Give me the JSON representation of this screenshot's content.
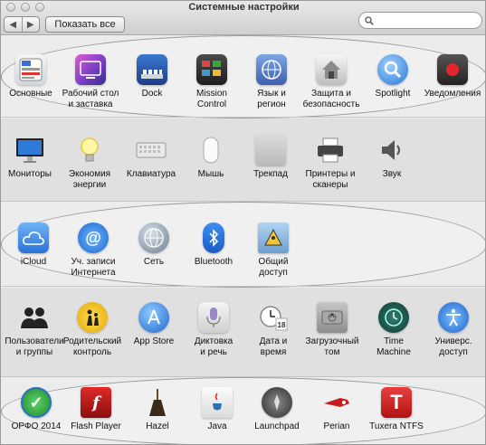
{
  "window": {
    "title": "Системные настройки"
  },
  "toolbar": {
    "back_label": "◀",
    "forward_label": "▶",
    "show_all_label": "Показать все",
    "search_value": "",
    "search_placeholder": ""
  },
  "row1": [
    {
      "label": "Основные",
      "icon": "general-icon"
    },
    {
      "label": "Рабочий стол\nи заставка",
      "icon": "desktop-screensaver-icon"
    },
    {
      "label": "Dock",
      "icon": "dock-icon"
    },
    {
      "label": "Mission\nControl",
      "icon": "mission-control-icon"
    },
    {
      "label": "Язык и\nрегион",
      "icon": "language-region-icon"
    },
    {
      "label": "Защита и\nбезопасность",
      "icon": "security-icon"
    },
    {
      "label": "Spotlight",
      "icon": "spotlight-icon"
    },
    {
      "label": "Уведомления",
      "icon": "notifications-icon"
    }
  ],
  "row2": [
    {
      "label": "Мониторы",
      "icon": "displays-icon"
    },
    {
      "label": "Экономия\nэнергии",
      "icon": "energy-saver-icon"
    },
    {
      "label": "Клавиатура",
      "icon": "keyboard-icon"
    },
    {
      "label": "Мышь",
      "icon": "mouse-icon"
    },
    {
      "label": "Трекпад",
      "icon": "trackpad-icon"
    },
    {
      "label": "Принтеры и\nсканеры",
      "icon": "printers-icon"
    },
    {
      "label": "Звук",
      "icon": "sound-icon"
    }
  ],
  "row3": [
    {
      "label": "iCloud",
      "icon": "icloud-icon"
    },
    {
      "label": "Уч. записи\nИнтернета",
      "icon": "internet-accounts-icon"
    },
    {
      "label": "Сеть",
      "icon": "network-icon"
    },
    {
      "label": "Bluetooth",
      "icon": "bluetooth-icon"
    },
    {
      "label": "Общий\nдоступ",
      "icon": "sharing-icon"
    }
  ],
  "row4": [
    {
      "label": "Пользователи\nи группы",
      "icon": "users-icon"
    },
    {
      "label": "Родительский\nконтроль",
      "icon": "parental-controls-icon"
    },
    {
      "label": "App Store",
      "icon": "app-store-icon"
    },
    {
      "label": "Диктовка\nи речь",
      "icon": "dictation-icon"
    },
    {
      "label": "Дата и\nвремя",
      "icon": "date-time-icon"
    },
    {
      "label": "Загрузочный\nтом",
      "icon": "startup-disk-icon"
    },
    {
      "label": "Time\nMachine",
      "icon": "time-machine-icon"
    },
    {
      "label": "Универс.\nдоступ",
      "icon": "accessibility-icon"
    }
  ],
  "row5": [
    {
      "label": "ОРФО 2014",
      "icon": "orfo-icon"
    },
    {
      "label": "Flash Player",
      "icon": "flash-player-icon"
    },
    {
      "label": "Hazel",
      "icon": "hazel-icon"
    },
    {
      "label": "Java",
      "icon": "java-icon"
    },
    {
      "label": "Launchpad",
      "icon": "launchpad-icon"
    },
    {
      "label": "Perian",
      "icon": "perian-icon"
    },
    {
      "label": "Tuxera NTFS",
      "icon": "tuxera-icon"
    }
  ]
}
